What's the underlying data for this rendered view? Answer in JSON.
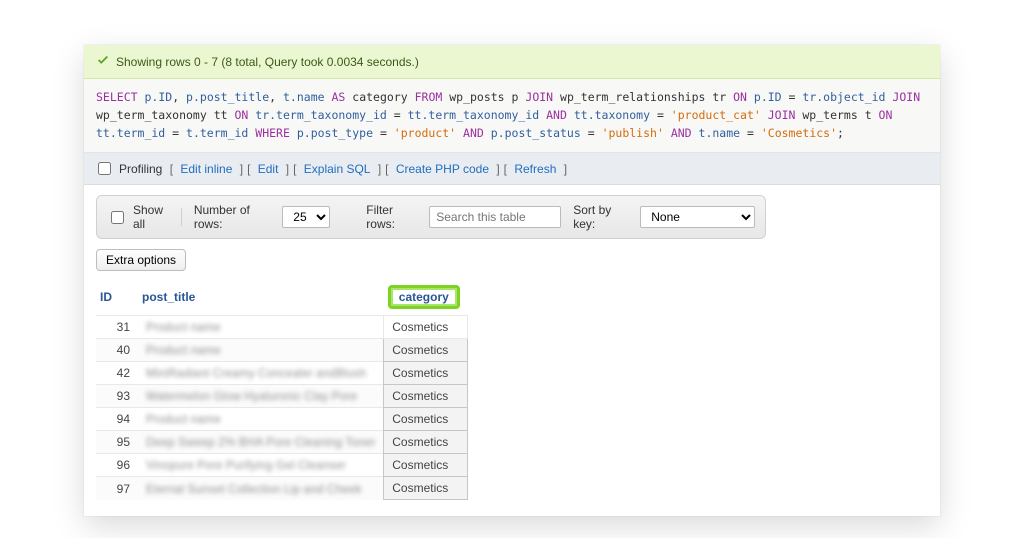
{
  "banner": {
    "message": "Showing rows 0 - 7 (8 total, Query took 0.0034 seconds.)"
  },
  "sql": {
    "tokens": [
      {
        "t": "kw",
        "v": "SELECT"
      },
      {
        "t": "tx",
        "v": " "
      },
      {
        "t": "id",
        "v": "p.ID"
      },
      {
        "t": "tx",
        "v": ", "
      },
      {
        "t": "id",
        "v": "p.post_title"
      },
      {
        "t": "tx",
        "v": ", "
      },
      {
        "t": "id",
        "v": "t.name"
      },
      {
        "t": "tx",
        "v": " "
      },
      {
        "t": "kw",
        "v": "AS"
      },
      {
        "t": "tx",
        "v": " category "
      },
      {
        "t": "kw",
        "v": "FROM"
      },
      {
        "t": "tx",
        "v": " wp_posts p "
      },
      {
        "t": "kw",
        "v": "JOIN"
      },
      {
        "t": "tx",
        "v": " wp_term_relationships tr "
      },
      {
        "t": "kw",
        "v": "ON"
      },
      {
        "t": "tx",
        "v": " "
      },
      {
        "t": "id",
        "v": "p.ID"
      },
      {
        "t": "tx",
        "v": " = "
      },
      {
        "t": "id",
        "v": "tr.object_id"
      },
      {
        "t": "tx",
        "v": " "
      },
      {
        "t": "kw",
        "v": "JOIN"
      },
      {
        "t": "tx",
        "v": " wp_term_taxonomy tt "
      },
      {
        "t": "kw",
        "v": "ON"
      },
      {
        "t": "tx",
        "v": " "
      },
      {
        "t": "id",
        "v": "tr.term_taxonomy_id"
      },
      {
        "t": "tx",
        "v": " = "
      },
      {
        "t": "id",
        "v": "tt.term_taxonomy_id"
      },
      {
        "t": "tx",
        "v": " "
      },
      {
        "t": "kw",
        "v": "AND"
      },
      {
        "t": "tx",
        "v": " "
      },
      {
        "t": "id",
        "v": "tt.taxonomy"
      },
      {
        "t": "tx",
        "v": " = "
      },
      {
        "t": "str",
        "v": "'product_cat'"
      },
      {
        "t": "tx",
        "v": " "
      },
      {
        "t": "kw",
        "v": "JOIN"
      },
      {
        "t": "tx",
        "v": " wp_terms t "
      },
      {
        "t": "kw",
        "v": "ON"
      },
      {
        "t": "tx",
        "v": " "
      },
      {
        "t": "id",
        "v": "tt.term_id"
      },
      {
        "t": "tx",
        "v": " = "
      },
      {
        "t": "id",
        "v": "t.term_id"
      },
      {
        "t": "tx",
        "v": " "
      },
      {
        "t": "kw",
        "v": "WHERE"
      },
      {
        "t": "tx",
        "v": " "
      },
      {
        "t": "id",
        "v": "p.post_type"
      },
      {
        "t": "tx",
        "v": " = "
      },
      {
        "t": "str",
        "v": "'product'"
      },
      {
        "t": "tx",
        "v": " "
      },
      {
        "t": "kw",
        "v": "AND"
      },
      {
        "t": "tx",
        "v": " "
      },
      {
        "t": "id",
        "v": "p.post_status"
      },
      {
        "t": "tx",
        "v": " = "
      },
      {
        "t": "str",
        "v": "'publish'"
      },
      {
        "t": "tx",
        "v": " "
      },
      {
        "t": "kw",
        "v": "AND"
      },
      {
        "t": "tx",
        "v": " "
      },
      {
        "t": "id",
        "v": "t.name"
      },
      {
        "t": "tx",
        "v": " = "
      },
      {
        "t": "str",
        "v": "'Cosmetics'"
      },
      {
        "t": "tx",
        "v": ";"
      }
    ]
  },
  "actionbar": {
    "profiling_label": "Profiling",
    "links": {
      "edit_inline": "Edit inline",
      "edit": "Edit",
      "explain": "Explain SQL",
      "create_php": "Create PHP code",
      "refresh": "Refresh"
    }
  },
  "controls": {
    "show_all_label": "Show all",
    "numrows_label": "Number of rows:",
    "numrows_value": "25",
    "filter_label": "Filter rows:",
    "filter_placeholder": "Search this table",
    "sortkey_label": "Sort by key:",
    "sortkey_value": "None"
  },
  "extra_btn_label": "Extra options",
  "table": {
    "headers": {
      "id": "ID",
      "title": "post_title",
      "category": "category"
    },
    "rows": [
      {
        "id": "31",
        "title": "Product name",
        "category": "Cosmetics"
      },
      {
        "id": "40",
        "title": "Product name",
        "category": "Cosmetics"
      },
      {
        "id": "42",
        "title": "MiniRadiant Creamy Concealer andBlush",
        "category": "Cosmetics"
      },
      {
        "id": "93",
        "title": "Watermelon Glow Hyaluronic Clay Pore",
        "category": "Cosmetics"
      },
      {
        "id": "94",
        "title": "Product name",
        "category": "Cosmetics"
      },
      {
        "id": "95",
        "title": "Deep Sweep 2% BHA Pore Cleaning Toner",
        "category": "Cosmetics"
      },
      {
        "id": "96",
        "title": "Vinopure Pore Purifying Gel Cleanser",
        "category": "Cosmetics"
      },
      {
        "id": "97",
        "title": "Eternal Sunset Collection Lip and Cheek",
        "category": "Cosmetics"
      }
    ]
  }
}
